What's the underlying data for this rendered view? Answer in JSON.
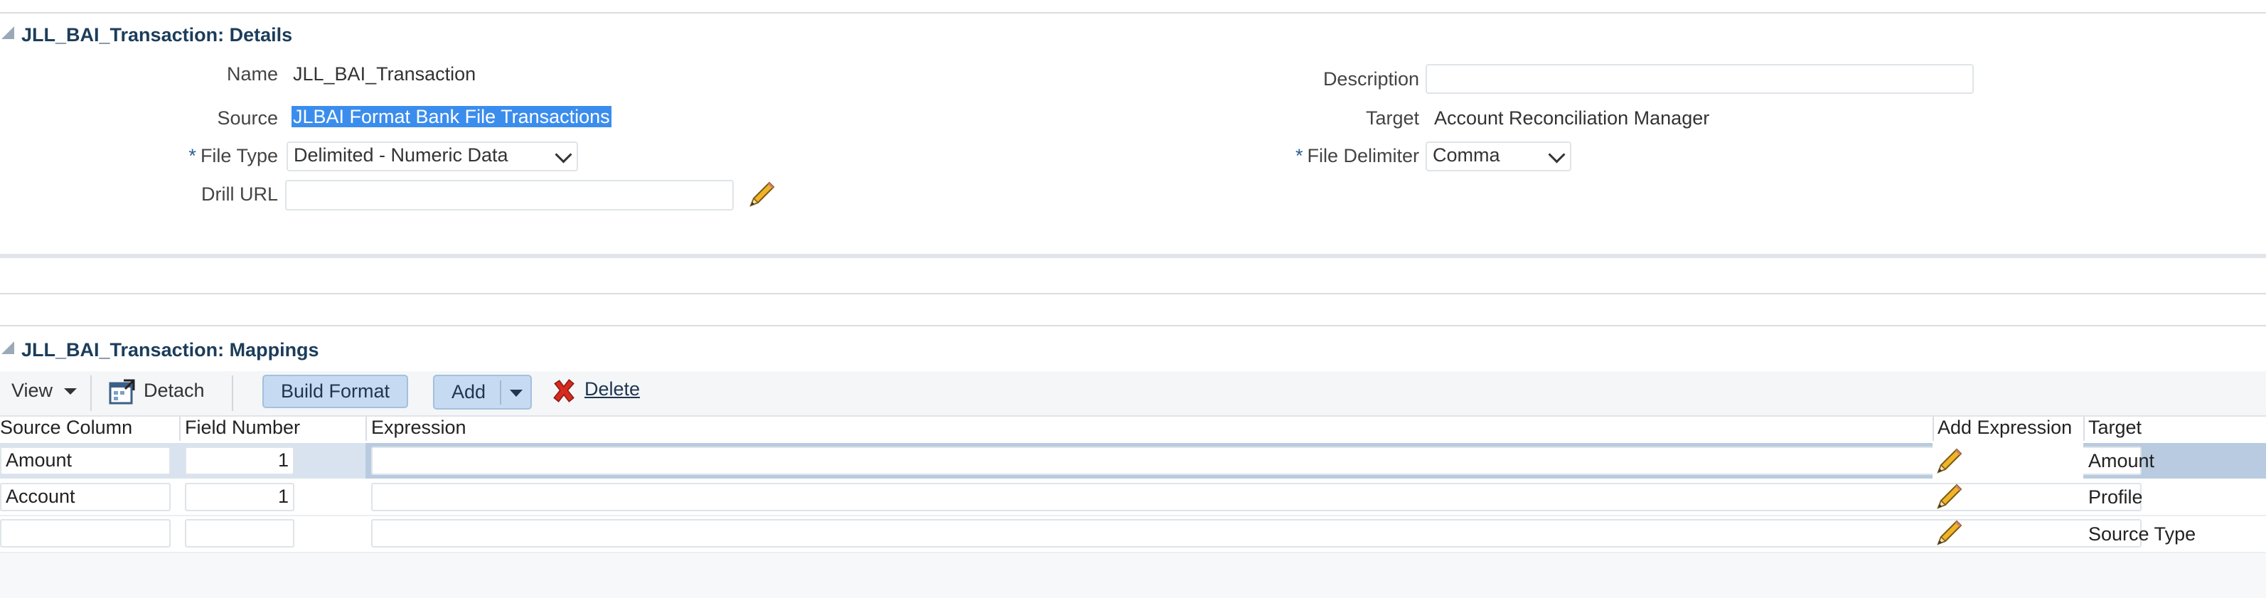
{
  "details": {
    "title": "JLL_BAI_Transaction: Details",
    "name_label": "Name",
    "name_value": "JLL_BAI_Transaction",
    "source_label": "Source",
    "source_value": "JLBAI Format Bank File Transactions",
    "file_type_label": "File Type",
    "file_type_value": "Delimited - Numeric Data",
    "drill_url_label": "Drill URL",
    "drill_url_value": "",
    "description_label": "Description",
    "description_value": "",
    "target_label": "Target",
    "target_value": "Account Reconciliation Manager",
    "file_delimiter_label": "File Delimiter",
    "file_delimiter_value": "Comma",
    "required_marker": "*"
  },
  "mappings": {
    "title": "JLL_BAI_Transaction: Mappings",
    "toolbar": {
      "view_label": "View",
      "detach_label": "Detach",
      "build_format_label": "Build Format",
      "add_label": "Add",
      "delete_label": "Delete"
    },
    "columns": [
      "Source Column",
      "Field Number",
      "Expression",
      "Add Expression",
      "Target"
    ],
    "rows": [
      {
        "source_column": "Amount",
        "field_number": "1",
        "expression": "",
        "target": "Amount",
        "selected": true
      },
      {
        "source_column": "Account",
        "field_number": "1",
        "expression": "",
        "target": "Profile",
        "selected": false
      },
      {
        "source_column": "",
        "field_number": "",
        "expression": "",
        "target": "Source Type",
        "selected": false
      }
    ]
  },
  "colors": {
    "section_title": "#1c3d5a",
    "selected_row": "#b9cbe0",
    "button_blue": "#c6dbf1",
    "text_selection": "#3b8ded",
    "delete_red": "#d62b1f",
    "required_star": "#2b5d96"
  },
  "icons": [
    "collapse-triangle-icon",
    "pencil-icon",
    "detach-icon",
    "dropdown-arrow-icon",
    "delete-x-icon"
  ]
}
